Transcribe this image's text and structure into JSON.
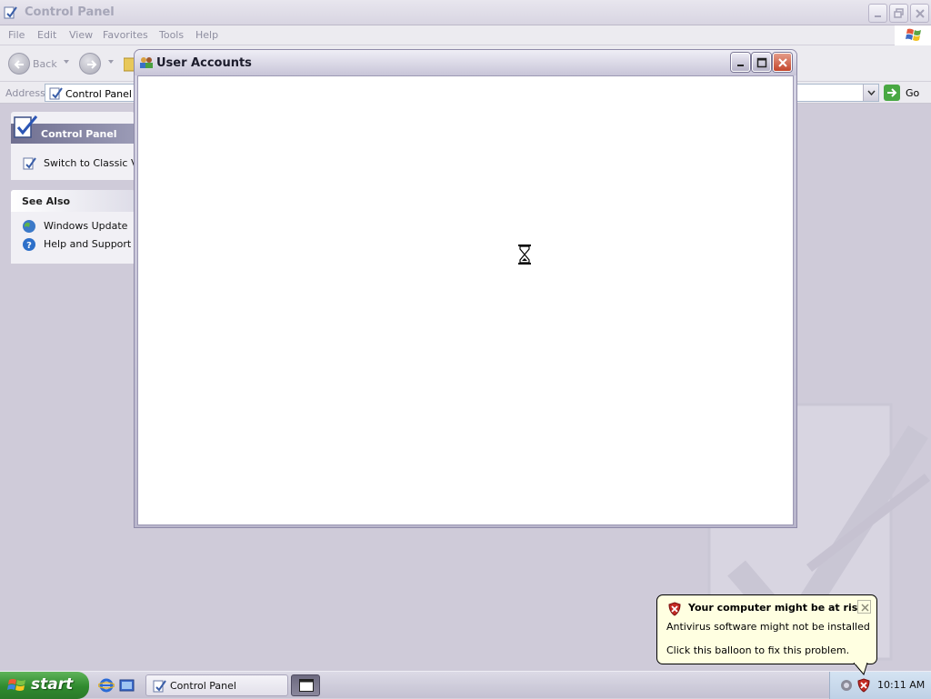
{
  "control_panel_window": {
    "title": "Control Panel",
    "menu": [
      "File",
      "Edit",
      "View",
      "Favorites",
      "Tools",
      "Help"
    ],
    "toolbar": {
      "back_label": "Back"
    },
    "address": {
      "label": "Address",
      "value": "Control Panel",
      "go_label": "Go"
    },
    "side_panel": {
      "control_panel_title": "Control Panel",
      "switch_view_label": "Switch to Classic View",
      "see_also_title": "See Also",
      "see_also_links": [
        "Windows Update",
        "Help and Support"
      ]
    }
  },
  "user_accounts_window": {
    "title": "User Accounts",
    "cursor": "hourglass-icon"
  },
  "taskbar": {
    "start_label": "start",
    "tasks": [
      {
        "label": "Control Panel",
        "icon": "control-panel-icon"
      },
      {
        "label": "",
        "icon": "window-icon"
      }
    ],
    "clock": "10:11 AM"
  },
  "balloon": {
    "title": "Your computer might be at risk",
    "line1": "Antivirus software might not be installed",
    "line2": "Click this balloon to fix this problem."
  },
  "colors": {
    "start_green": "#2f8a2e",
    "balloon_bg": "#ffffe1",
    "close_red": "#c4462c"
  }
}
